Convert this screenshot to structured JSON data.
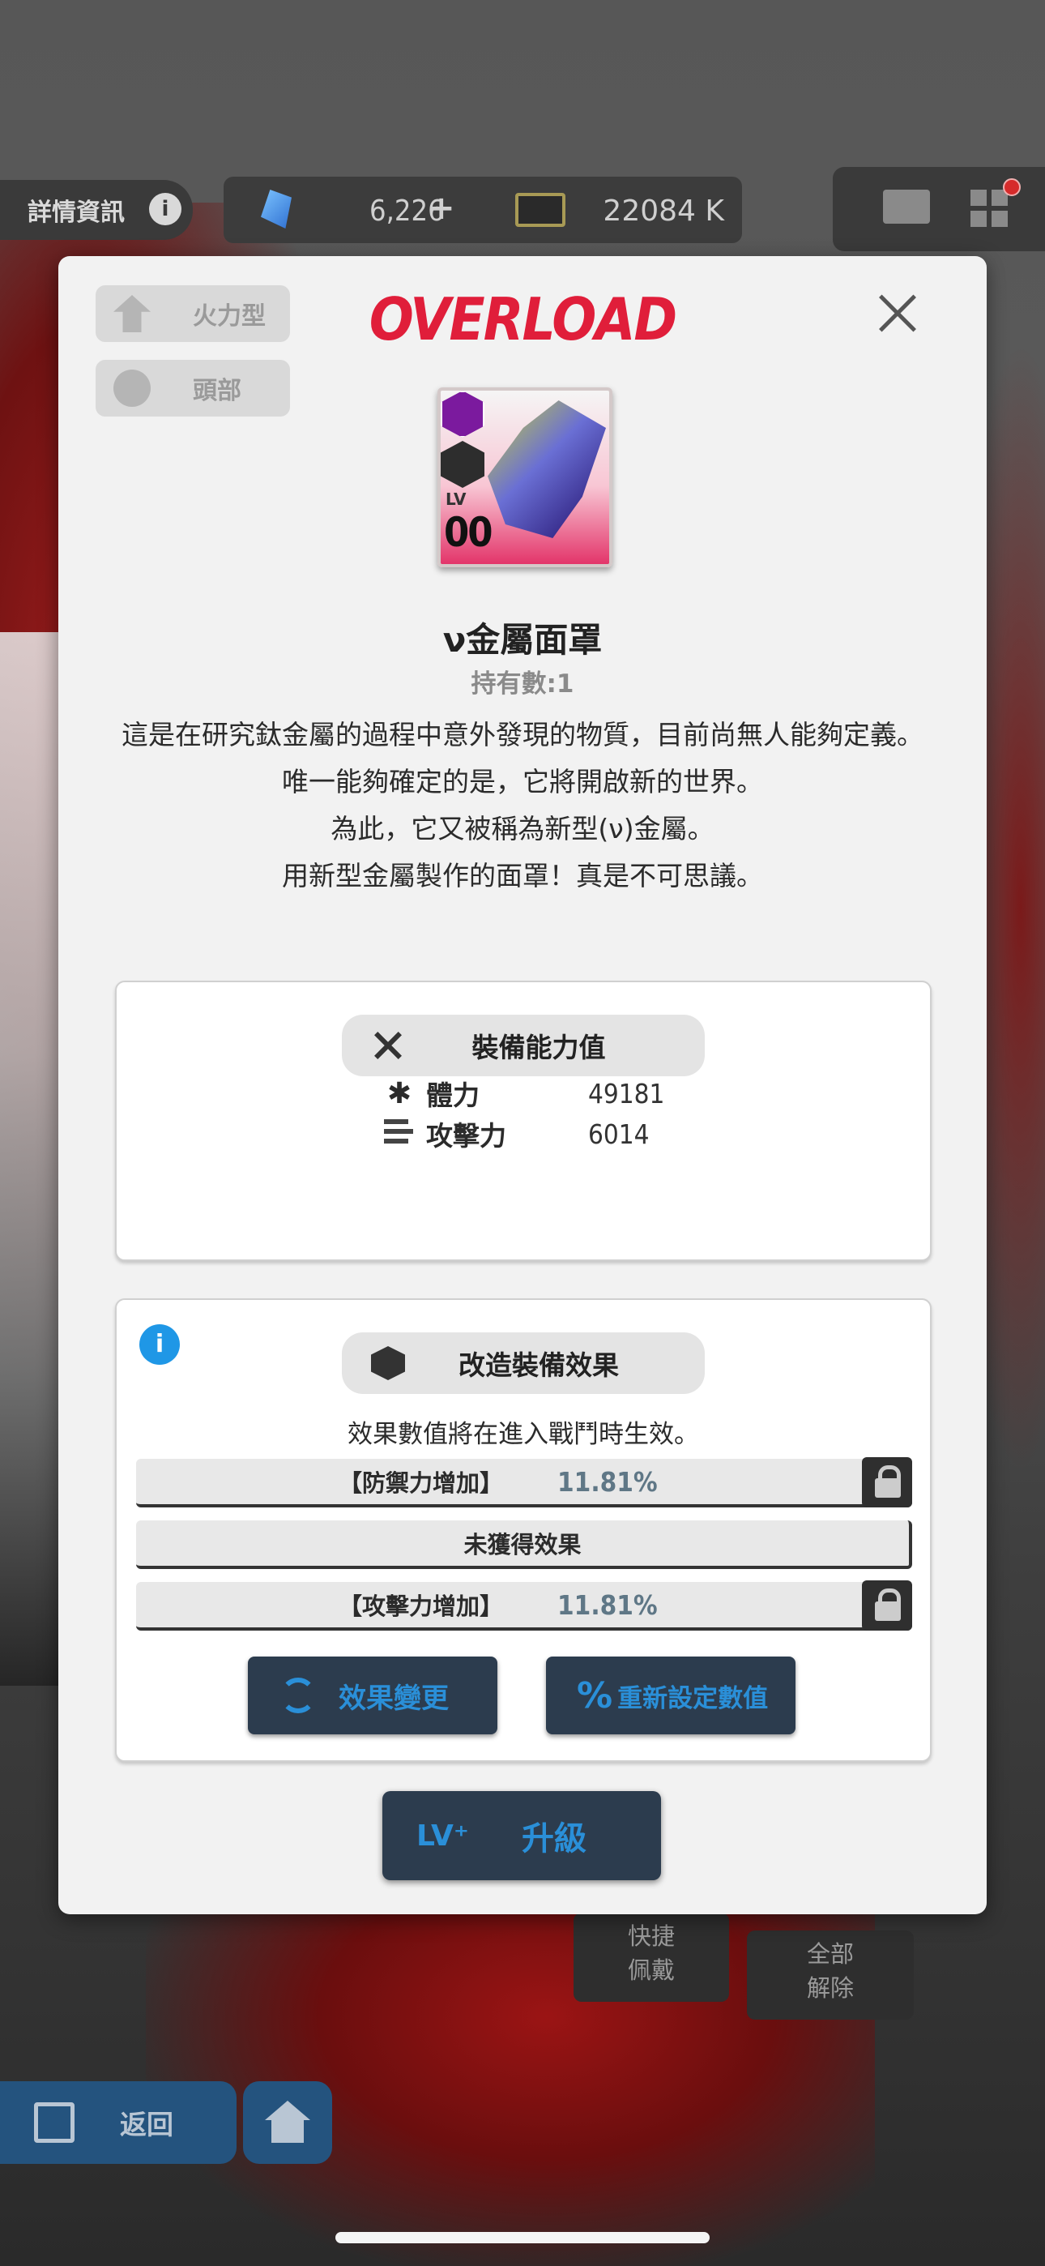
{
  "topbar": {
    "detail_label": "詳情資訊",
    "detail_info_icon": "info-icon",
    "gems": "6,226",
    "gems_add": "+",
    "credits": "22084 K"
  },
  "modal": {
    "brand": "OVERLOAD",
    "tags": [
      {
        "label": "火力型",
        "icon": "firepower-class-icon"
      },
      {
        "label": "頭部",
        "icon": "helmet-icon"
      }
    ],
    "item": {
      "lv_label": "LV",
      "lv_value": "00",
      "name": "ν金屬面罩",
      "owned": "持有數:1",
      "description": [
        "這是在研究鈦金屬的過程中意外發現的物質，目前尚無人能夠定義。",
        "唯一能夠確定的是，它將開啟新的世界。",
        "為此，它又被稱為新型(ν)金屬。",
        "用新型金屬製作的面罩！真是不可思議。"
      ]
    },
    "stats_panel": {
      "title": "裝備能力值",
      "hp_label": "體力",
      "hp_value": "49181",
      "atk_label": "攻擊力",
      "atk_value": "6014"
    },
    "mod_panel": {
      "title": "改造裝備效果",
      "info_icon": "i",
      "note": "效果數值將在進入戰鬥時生效。",
      "effects": [
        {
          "name": "【防禦力增加】",
          "value": "11.81%",
          "locked": true
        },
        {
          "name": "未獲得效果",
          "value": "",
          "locked": false
        },
        {
          "name": "【攻擊力增加】",
          "value": "11.81%",
          "locked": true
        }
      ],
      "change_label": "效果變更",
      "reset_icon": "%",
      "reset_label": "重新設定數值"
    },
    "upgrade": {
      "icon_text": "LV⁺",
      "label": "升級"
    }
  },
  "bottombar": {
    "quick_wear": [
      "快捷",
      "佩戴"
    ],
    "release_all": [
      "全部",
      "解除"
    ],
    "back_label": "返回"
  },
  "colors": {
    "brand_red": "#e01e3a",
    "accent_blue": "#2a8fd8",
    "button_navy": "#2c3c4e",
    "info_blue": "#1f97e6"
  }
}
